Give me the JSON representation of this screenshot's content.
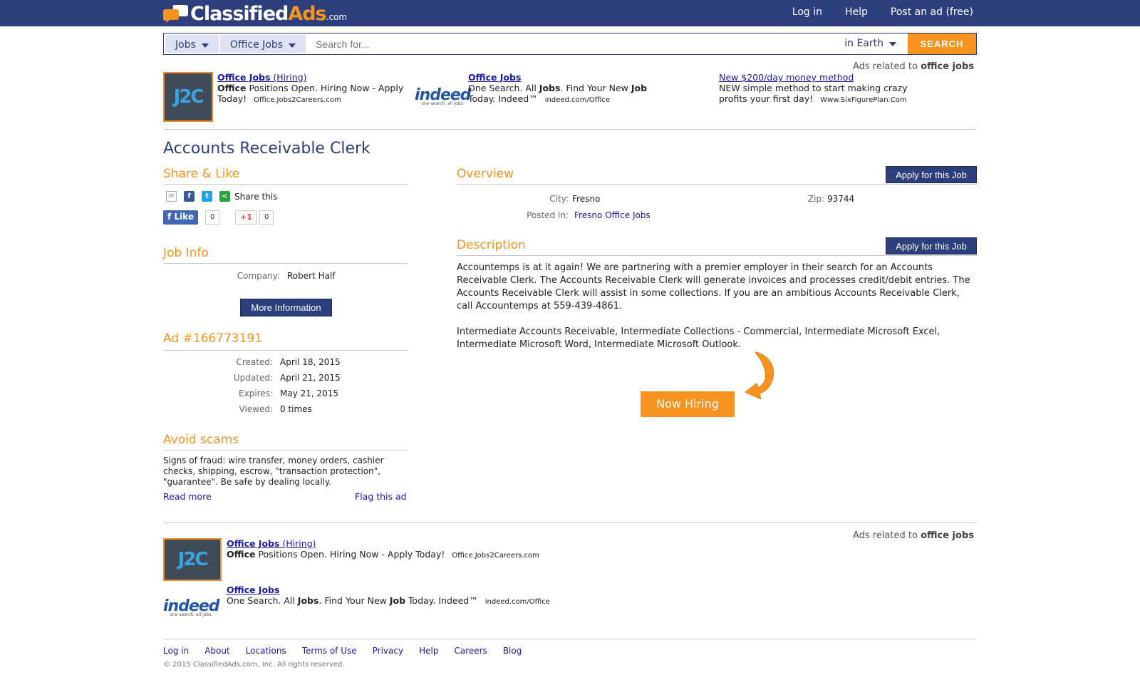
{
  "header": {
    "logo": {
      "classified": "Classified",
      "ads": "Ads",
      "com": ".com"
    },
    "nav": [
      "Log in",
      "Help",
      "Post an ad (free)"
    ]
  },
  "search": {
    "category": "Jobs",
    "subcategory": "Office Jobs",
    "placeholder": "Search for...",
    "location": "in Earth",
    "button": "SEARCH"
  },
  "top_ads": {
    "related_prefix": "Ads related to",
    "related_term": "office jobs",
    "items": [
      {
        "title_bold": "Office Jobs",
        "title_rest": " (Hiring)",
        "body_bold": "Office",
        "body": " Positions Open. Hiring Now - Apply Today!",
        "url": "Office.Jobs2Careers.com",
        "logo": "J2C"
      },
      {
        "title_bold": "Office Jobs",
        "title_rest": "",
        "body_pre": "One Search. All ",
        "body_b1": "Jobs",
        "body_mid": ". Find Your New ",
        "body_b2": "Job",
        "body_post": " Today. Indeed™",
        "url": "indeed.com/Office",
        "logo": "indeed",
        "logo_tag": "one search. all jobs."
      },
      {
        "title": "New $200/day money method",
        "body": "NEW simple method to start making crazy profits your first day!",
        "url": "Www.SixFigurePlan.Com"
      }
    ]
  },
  "page_title": "Accounts Receivable Clerk",
  "share": {
    "heading": "Share & Like",
    "share_this": "Share this",
    "like": "Like",
    "like_count": "0",
    "gplus": "+1",
    "gplus_count": "0"
  },
  "job_info": {
    "heading": "Job Info",
    "company_label": "Company:",
    "company": "Robert Half",
    "more_info": "More Information"
  },
  "ad_info": {
    "heading": "Ad #166773191",
    "created_label": "Created:",
    "created": "April 18, 2015",
    "updated_label": "Updated:",
    "updated": "April 21, 2015",
    "expires_label": "Expires:",
    "expires": "May 21, 2015",
    "viewed_label": "Viewed:",
    "viewed": "0 times"
  },
  "scams": {
    "heading": "Avoid scams",
    "text": "Signs of fraud: wire transfer, money orders, cashier checks, shipping, escrow, \"transaction protection\", \"guarantee\". Be safe by dealing locally.",
    "read_more": "Read more",
    "flag": "Flag this ad"
  },
  "overview": {
    "heading": "Overview",
    "apply": "Apply for this Job",
    "city_label": "City:",
    "city": "Fresno",
    "zip_label": "Zip:",
    "zip": "93744",
    "posted_label": "Posted in:",
    "posted": "Fresno Office Jobs"
  },
  "description": {
    "heading": "Description",
    "apply": "Apply for this Job",
    "p1": "Accountemps is at it again! We are partnering with a premier employer in their search for an Accounts Receivable Clerk. The Accounts Receivable Clerk will generate invoices and processes credit/debit entries. The Accounts Receivable Clerk will assist in some collections. If you are an ambitious Accounts Receivable Clerk, call Accountemps at 559-439-4861.",
    "p2": "Intermediate Accounts Receivable, Intermediate Collections - Commercial, Intermediate Microsoft Excel, Intermediate Microsoft Word, Intermediate Microsoft Outlook.",
    "now_hiring": "Now Hiring"
  },
  "bottom_ads": {
    "related_prefix": "Ads related to",
    "related_term": "office jobs"
  },
  "footer": {
    "links": [
      "Log in",
      "About",
      "Locations",
      "Terms of Use",
      "Privacy",
      "Help",
      "Careers",
      "Blog"
    ],
    "copyright": "© 2015 ClassifiedAds.com, Inc. All rights reserved."
  },
  "colors": {
    "navy": "#2c3e7b",
    "orange": "#f7931e",
    "link": "#1a1aa6"
  }
}
